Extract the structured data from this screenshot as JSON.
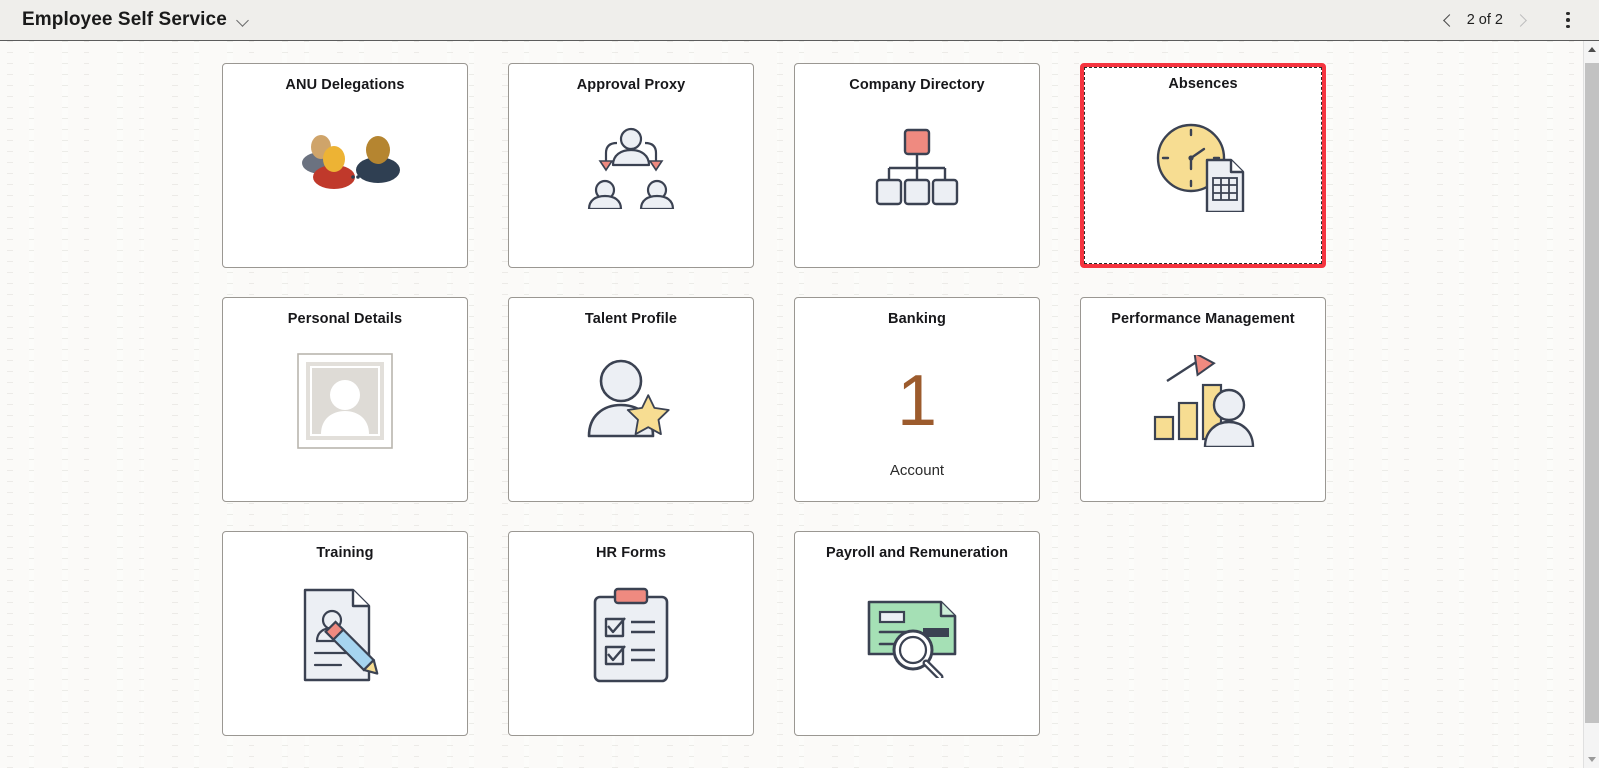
{
  "header": {
    "title": "Employee Self Service",
    "dropdown_icon": "chevron-down-icon",
    "pager": {
      "prev_icon": "chevron-left-icon",
      "next_icon": "chevron-right-icon",
      "label": "2 of 2"
    },
    "actions_icon": "kebab-menu-icon"
  },
  "tiles": [
    [
      {
        "title": "ANU Delegations",
        "icon": "people-group-delegation-icon",
        "selected": false
      },
      {
        "title": "Approval Proxy",
        "icon": "org-approval-arrows-icon",
        "selected": false
      },
      {
        "title": "Company Directory",
        "icon": "org-chart-icon",
        "selected": false
      },
      {
        "title": "Absences",
        "icon": "clock-document-icon",
        "selected": true
      }
    ],
    [
      {
        "title": "Personal Details",
        "icon": "framed-portrait-icon",
        "selected": false
      },
      {
        "title": "Talent Profile",
        "icon": "person-star-icon",
        "selected": false
      },
      {
        "title": "Banking",
        "icon": "",
        "selected": false,
        "count": "1",
        "count_label": "Account"
      },
      {
        "title": "Performance Management",
        "icon": "bar-chart-person-icon",
        "selected": false
      }
    ],
    [
      {
        "title": "Training",
        "icon": "document-pencil-icon",
        "selected": false
      },
      {
        "title": "HR Forms",
        "icon": "clipboard-checklist-icon",
        "selected": false
      },
      {
        "title": "Payroll and Remuneration",
        "icon": "cheque-magnifier-icon",
        "selected": false
      }
    ]
  ],
  "scrollbar": {
    "up_icon": "scroll-up-arrow-icon",
    "down_icon": "scroll-down-arrow-icon"
  },
  "colors": {
    "selection_red": "#f5343f",
    "header_bg": "#efeeeb",
    "page_bg": "#fbfaf8",
    "tile_border": "#9a9792",
    "banking_number": "#9c5b2d",
    "icon_outline": "#3b4252",
    "icon_fill": "#eceff4",
    "accent_salmon": "#ef8a80",
    "accent_yellow": "#f7dd92",
    "accent_green": "#a5e0b5",
    "accent_blue": "#a6d4ef"
  }
}
